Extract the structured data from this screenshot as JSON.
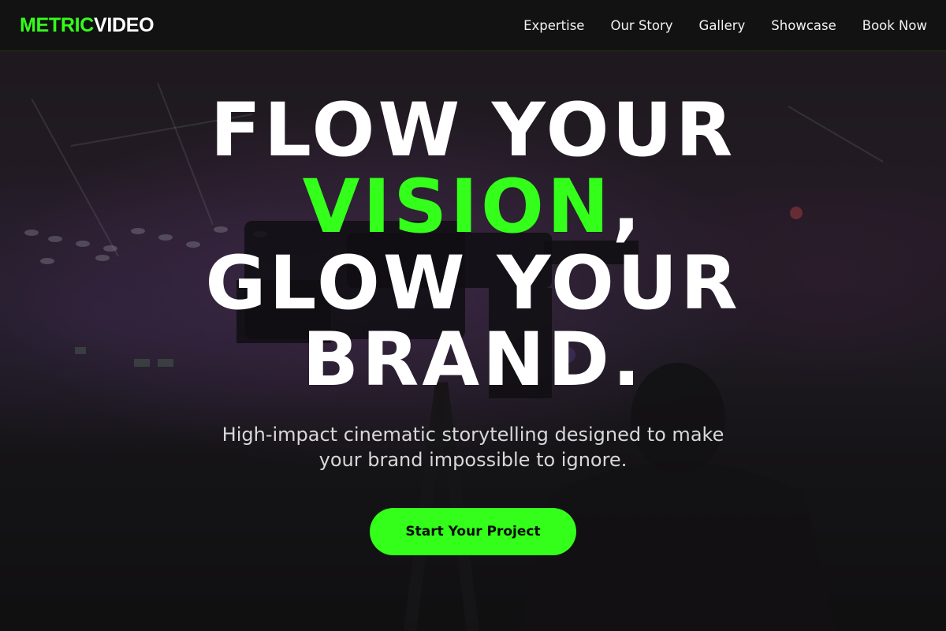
{
  "brand": {
    "part1": "METRIC",
    "part2": "VIDEO",
    "accent_color": "#33ff1a"
  },
  "nav": {
    "items": [
      "Expertise",
      "Our Story",
      "Gallery",
      "Showcase",
      "Book Now"
    ]
  },
  "hero": {
    "line1": "FLOW YOUR",
    "line2_accent": "VISION",
    "line2_punct": ",",
    "line3": "GLOW YOUR",
    "line4": "BRAND.",
    "subtitle": "High-impact cinematic storytelling designed to make your brand impossible to ignore.",
    "cta_label": "Start Your Project",
    "background": "camera-operator-stage-photo"
  }
}
